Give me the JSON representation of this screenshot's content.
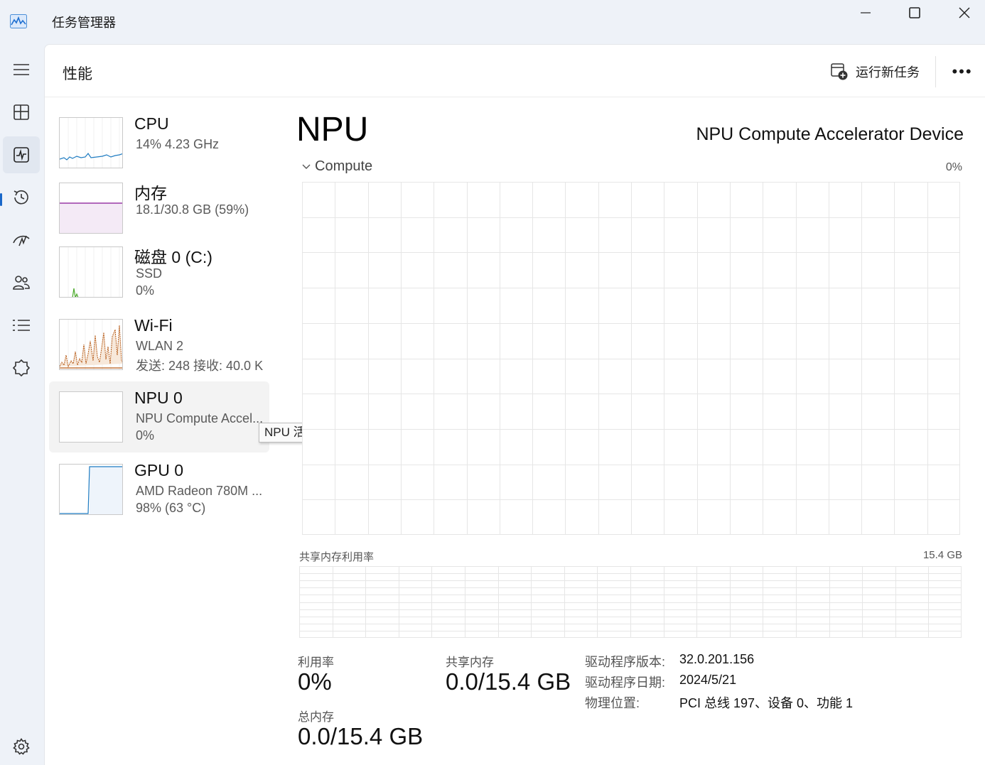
{
  "window": {
    "title": "任务管理器",
    "accent": "#1967c9"
  },
  "rail": {
    "items": [
      "menu-icon",
      "processes-icon",
      "performance-icon",
      "app-history-icon",
      "startup-apps-icon",
      "users-icon",
      "details-icon",
      "services-icon",
      "settings-icon"
    ],
    "active": "performance-icon"
  },
  "header": {
    "title": "性能",
    "run_task_label": "运行新任务",
    "more_label": "•••"
  },
  "devices": [
    {
      "name": "CPU",
      "sub1": "14%  4.23 GHz",
      "sub2": "",
      "color": "#1f7cc2"
    },
    {
      "name": "内存",
      "sub1": "18.1/30.8 GB (59%)",
      "sub2": "",
      "color": "#9a3aa6"
    },
    {
      "name": "磁盘 0 (C:)",
      "sub1": "SSD",
      "sub2": "0%",
      "color": "#4caa2c"
    },
    {
      "name": "Wi-Fi",
      "sub1": "WLAN 2",
      "sub2": "发送: 248  接收: 40.0 K",
      "color": "#b65a16"
    },
    {
      "name": "NPU 0",
      "sub1": "NPU Compute Accel...",
      "sub2": "0%",
      "color": "#1f7cc2"
    },
    {
      "name": "GPU 0",
      "sub1": "AMD Radeon 780M ...",
      "sub2": "98%  (63 °C)",
      "color": "#1f7cc2"
    }
  ],
  "tooltip": "NPU 活动",
  "detail": {
    "title": "NPU",
    "device_name": "NPU Compute Accelerator Device",
    "compute_label": "Compute",
    "compute_pct": "0%",
    "shared_mem_label": "共享内存利用率",
    "shared_mem_max": "15.4 GB",
    "stats": {
      "utilization_label": "利用率",
      "utilization_value": "0%",
      "shared_mem_label": "共享内存",
      "shared_mem_value": "0.0/15.4 GB",
      "total_mem_label": "总内存",
      "total_mem_value": "0.0/15.4 GB"
    },
    "info": [
      {
        "key": "驱动程序版本:",
        "value": "32.0.201.156"
      },
      {
        "key": "驱动程序日期:",
        "value": "2024/5/21"
      },
      {
        "key": "物理位置:",
        "value": "PCI 总线 197、设备 0、功能 1"
      }
    ]
  }
}
